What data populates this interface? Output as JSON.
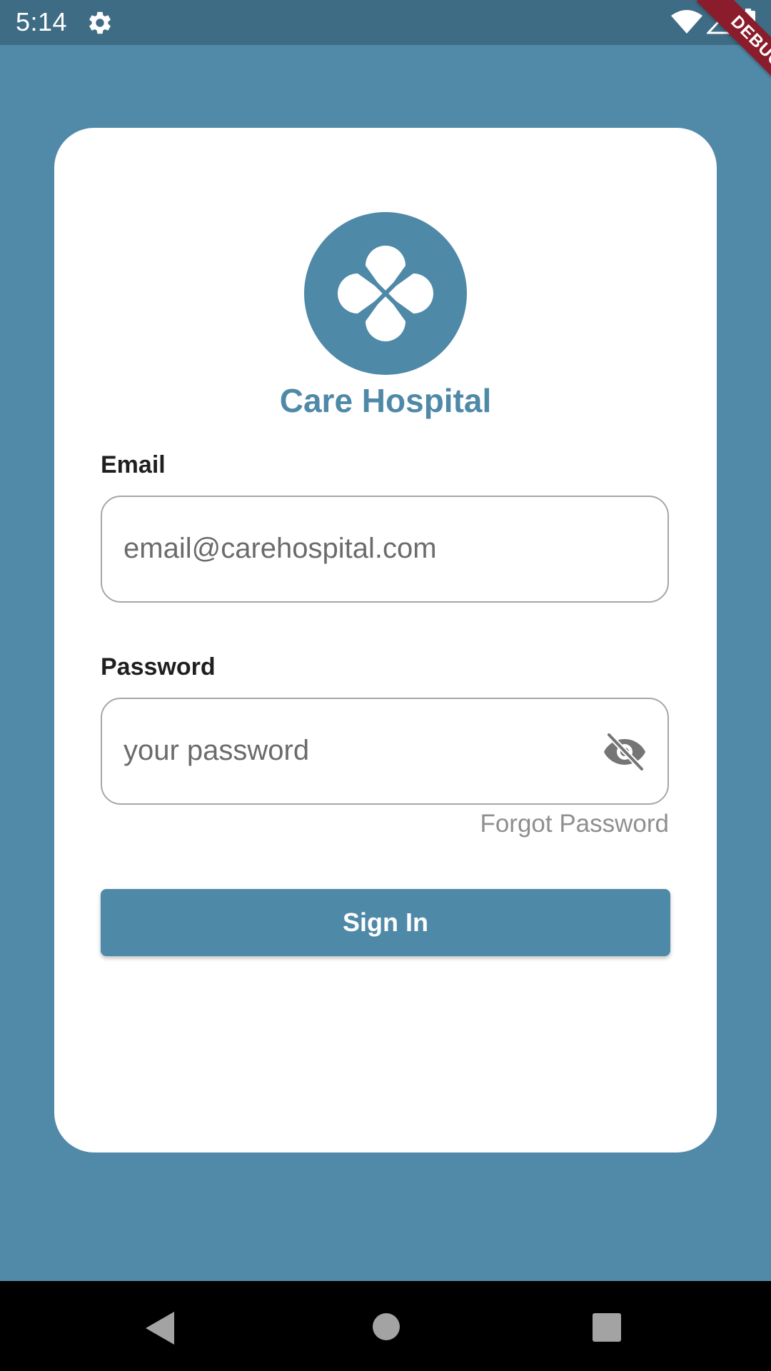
{
  "status_bar": {
    "time": "5:14",
    "icons": [
      "gear-icon",
      "wifi-icon",
      "signal-icon",
      "battery-icon"
    ]
  },
  "debug_banner": {
    "label": "DEBUG"
  },
  "brand": {
    "name": "Care Hospital",
    "logo_icon": "clover-logo-icon",
    "accent_color": "#4f89a8",
    "background_color": "#518aa8"
  },
  "form": {
    "email": {
      "label": "Email",
      "placeholder": "email@carehospital.com",
      "value": ""
    },
    "password": {
      "label": "Password",
      "placeholder": "your password",
      "value": "",
      "toggle_icon": "eye-off-icon"
    },
    "forgot_password": "Forgot Password",
    "submit_label": "Sign In"
  },
  "nav_bar": {
    "icons": [
      "back-icon",
      "home-icon",
      "recents-icon"
    ]
  }
}
